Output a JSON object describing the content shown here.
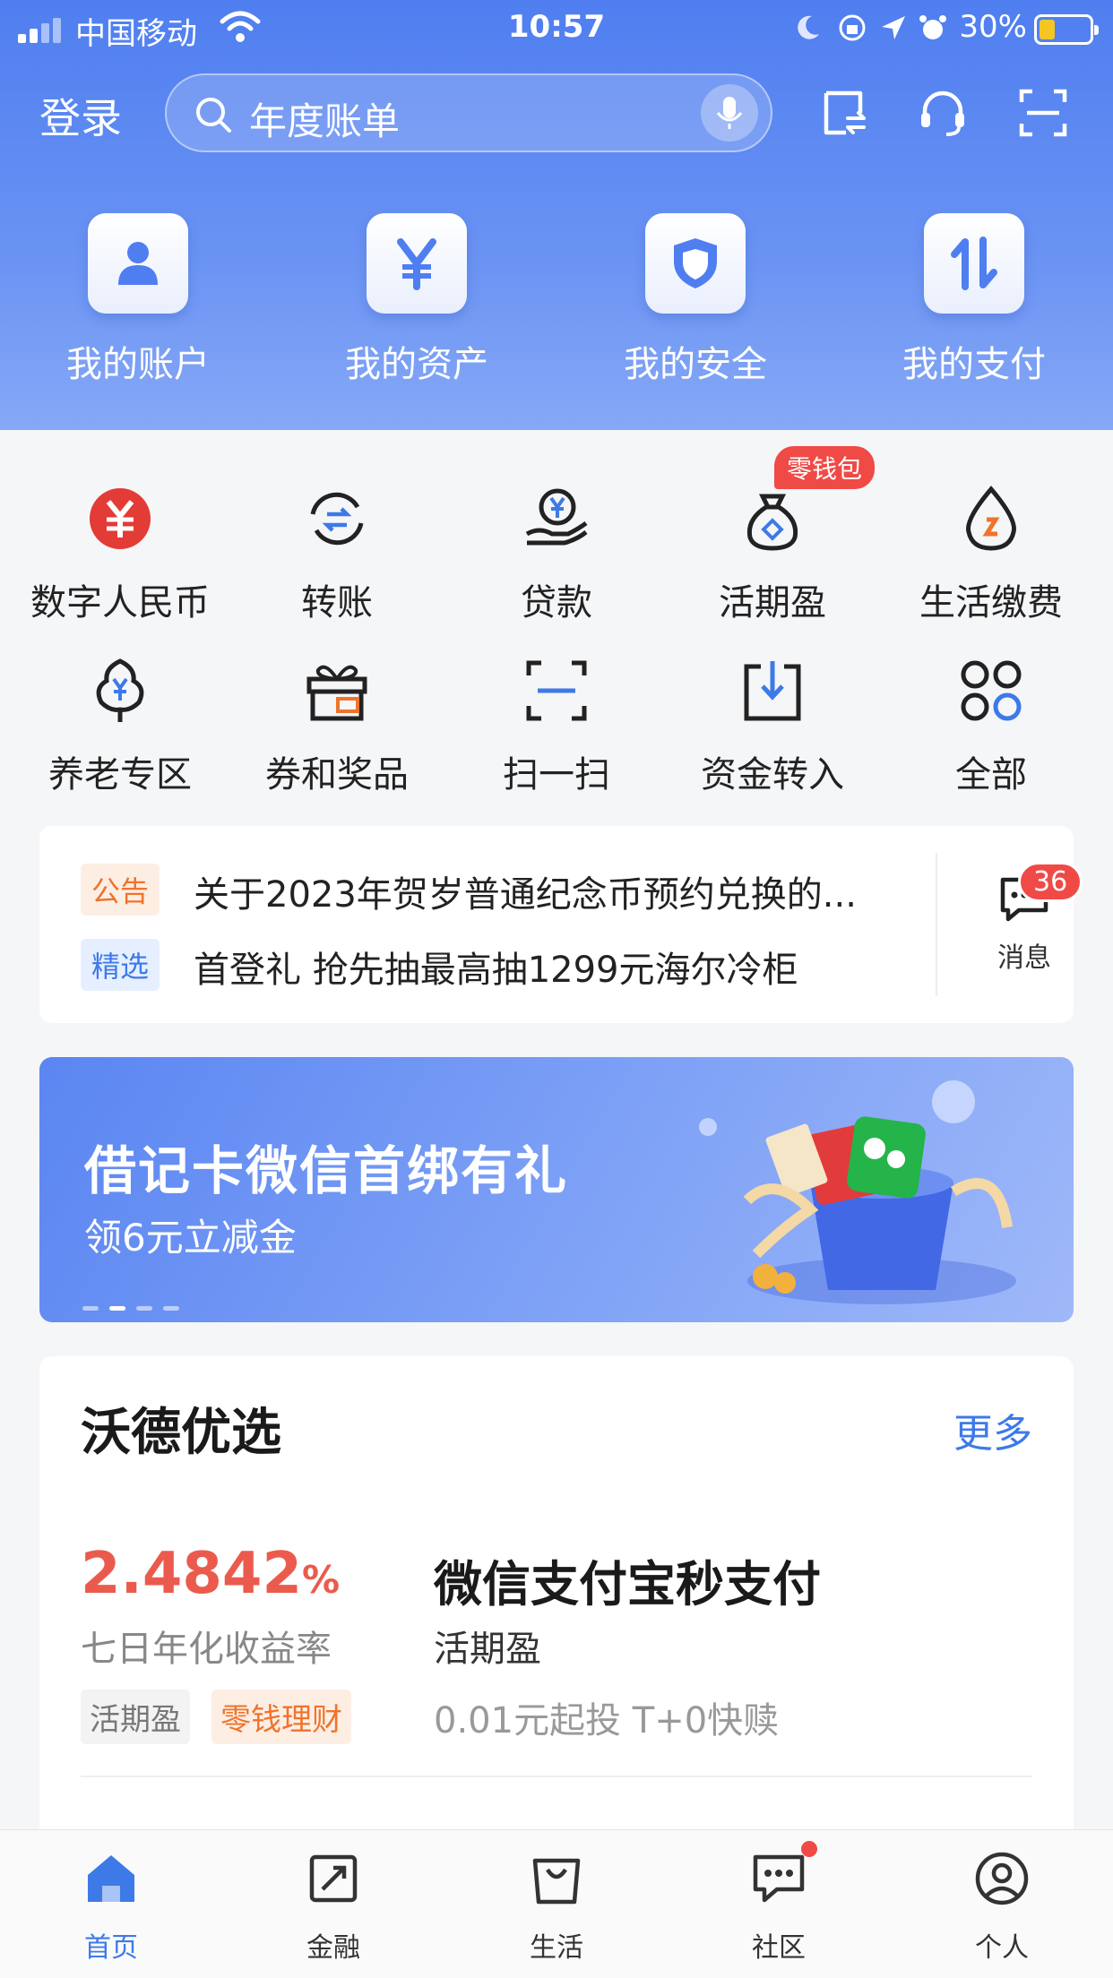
{
  "status_bar": {
    "carrier": "中国移动",
    "time": "10:57",
    "battery": "30%"
  },
  "header": {
    "login": "登录",
    "search_placeholder": "年度账单",
    "main_entries": [
      {
        "label": "我的账户",
        "icon": "user-icon"
      },
      {
        "label": "我的资产",
        "icon": "yen-icon"
      },
      {
        "label": "我的安全",
        "icon": "shield-icon"
      },
      {
        "label": "我的支付",
        "icon": "transfer-arrows-icon"
      }
    ]
  },
  "quick": {
    "row1": [
      "数字人民币",
      "转账",
      "贷款",
      "活期盈",
      "生活缴费"
    ],
    "row2": [
      "养老专区",
      "券和奖品",
      "扫一扫",
      "资金转入",
      "全部"
    ],
    "wallet_badge": "零钱包"
  },
  "notice": {
    "tag1": "公告",
    "line1": "关于2023年贺岁普通纪念币预约兑换的...",
    "tag2": "精选",
    "line2": "首登礼 抢先抽最高抽1299元海尔冷柜",
    "message_label": "消息",
    "message_count": "36"
  },
  "banner": {
    "title": "借记卡微信首绑有礼",
    "subtitle": "领6元立减金"
  },
  "recommend": {
    "title": "沃德优选",
    "more": "更多",
    "rate": "2.4842",
    "rate_unit": "%",
    "rate_label": "七日年化收益率",
    "chip1": "活期盈",
    "chip2": "零钱理财",
    "product_name": "微信支付宝秒支付",
    "product_sub": "活期盈",
    "product_desc": "0.01元起投 T+0快赎"
  },
  "tabs": [
    {
      "label": "首页",
      "icon": "home-icon"
    },
    {
      "label": "金融",
      "icon": "finance-icon"
    },
    {
      "label": "生活",
      "icon": "shopping-bag-icon"
    },
    {
      "label": "社区",
      "icon": "chat-icon"
    },
    {
      "label": "个人",
      "icon": "profile-icon"
    }
  ],
  "colors": {
    "brand": "#4f7ef0",
    "accent_red": "#f04a47",
    "link_blue": "#3d7ae8",
    "rate_red": "#eb5b4d"
  }
}
